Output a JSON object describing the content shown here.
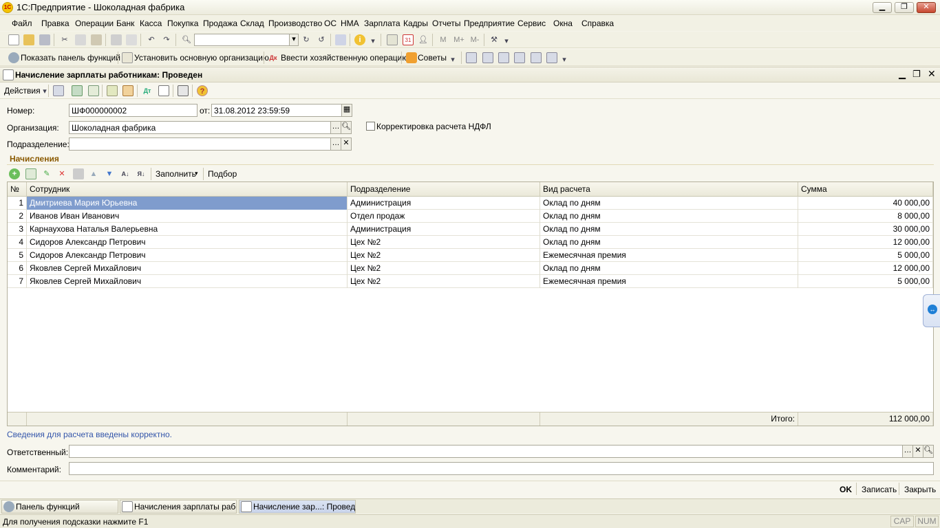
{
  "window": {
    "title": "1С:Предприятие - Шоколадная фабрика",
    "logo": "1С"
  },
  "menu": [
    "Файл",
    "Правка",
    "Операции",
    "Банк",
    "Касса",
    "Покупка",
    "Продажа",
    "Склад",
    "Производство",
    "ОС",
    "НМА",
    "Зарплата",
    "Кадры",
    "Отчеты",
    "Предприятие",
    "Сервис",
    "Окна",
    "Справка"
  ],
  "toolbar2": {
    "show_panel": "Показать панель функций",
    "set_org": "Установить основную организацию",
    "enter_op": "Ввести хозяйственную операцию",
    "tips": "Советы"
  },
  "document": {
    "title": "Начисление зарплаты работникам: Проведен",
    "actions_label": "Действия",
    "number_label": "Номер:",
    "number_value": "ШФ000000002",
    "date_label": "от:",
    "date_value": "31.08.2012 23:59:59",
    "org_label": "Организация:",
    "org_value": "Шоколадная фабрика",
    "dept_label": "Подразделение:",
    "dept_value": "",
    "ndfl_checkbox": "Корректировка расчета НДФЛ",
    "section_title": "Начисления",
    "fill_button": "Заполнить",
    "pick_button": "Подбор",
    "columns": [
      "№",
      "Сотрудник",
      "Подразделение",
      "Вид расчета",
      "Сумма"
    ],
    "rows": [
      {
        "n": "1",
        "employee": "Дмитриева Мария Юрьевна",
        "dept": "Администрация",
        "type": "Оклад по дням",
        "sum": "40 000,00"
      },
      {
        "n": "2",
        "employee": "Иванов Иван Иванович",
        "dept": "Отдел продаж",
        "type": "Оклад по дням",
        "sum": "8 000,00"
      },
      {
        "n": "3",
        "employee": "Карнаухова Наталья Валерьевна",
        "dept": "Администрация",
        "type": "Оклад по дням",
        "sum": "30 000,00"
      },
      {
        "n": "4",
        "employee": "Сидоров Александр Петрович",
        "dept": "Цех №2",
        "type": "Оклад по дням",
        "sum": "12 000,00"
      },
      {
        "n": "5",
        "employee": "Сидоров Александр Петрович",
        "dept": "Цех №2",
        "type": "Ежемесячная премия",
        "sum": "5 000,00"
      },
      {
        "n": "6",
        "employee": "Яковлев Сергей Михайлович",
        "dept": "Цех №2",
        "type": "Оклад по дням",
        "sum": "12 000,00"
      },
      {
        "n": "7",
        "employee": "Яковлев Сергей Михайлович",
        "dept": "Цех №2",
        "type": "Ежемесячная премия",
        "sum": "5 000,00"
      }
    ],
    "total_label": "Итого:",
    "total_value": "112 000,00",
    "info_text": "Сведения для расчета введены корректно.",
    "responsible_label": "Ответственный:",
    "responsible_value": "",
    "comment_label": "Комментарий:",
    "comment_value": "",
    "ok_button": "OK",
    "save_button": "Записать",
    "close_button": "Закрыть"
  },
  "taskbar": [
    "Панель функций",
    "Начисления зарплаты рабо...",
    "Начисление зар...: Проведен"
  ],
  "status": {
    "hint": "Для получения подсказки нажмите F1",
    "cap": "CAP",
    "num": "NUM"
  },
  "colors": {
    "selection": "#7f9ccd",
    "section_title": "#8a5a00",
    "info_text": "#3355aa"
  }
}
